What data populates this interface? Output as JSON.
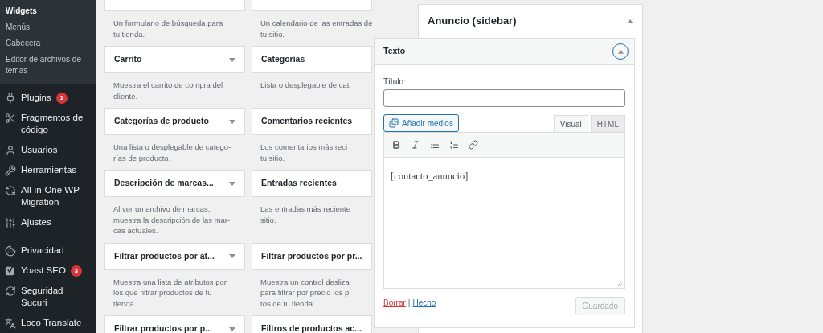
{
  "admin_menu": {
    "submenu": [
      {
        "label": "Widgets",
        "selected": true
      },
      {
        "label": "Menús",
        "selected": false
      },
      {
        "label": "Cabecera",
        "selected": false
      },
      {
        "label": "Editor de archivos de temas",
        "selected": false
      }
    ],
    "groups": [
      {
        "items": [
          {
            "label": "Plugins",
            "badge": "1"
          },
          {
            "label": "Fragmentos de código"
          },
          {
            "label": "Usuarios"
          },
          {
            "label": "Herramientas"
          },
          {
            "label": "All-in-One WP Migration"
          },
          {
            "label": "Ajustes"
          }
        ]
      },
      {
        "items": [
          {
            "label": "Privacidad"
          },
          {
            "label": "Yoast SEO",
            "badge": "3"
          },
          {
            "label": "Seguridad Sucuri"
          },
          {
            "label": "Loco Translate"
          }
        ]
      }
    ]
  },
  "available_widgets": {
    "rows": [
      {
        "left": {
          "description_lines": [
            "Un formulario de búsqueda para",
            "tu tienda."
          ]
        },
        "right": {
          "description_lines": [
            "Un calendario de las entradas de",
            "tu sitio."
          ]
        }
      },
      {
        "left": {
          "title": "Carrito",
          "description_lines": [
            "Muestra el carrito de compra del",
            "cliente."
          ]
        },
        "right": {
          "title": "Categorías",
          "description_lines": [
            "Lista o desplegable de cat"
          ]
        }
      },
      {
        "left": {
          "title": "Categorías de producto",
          "description_lines": [
            "Una lista o desplegable de catego-",
            "rías de producto."
          ]
        },
        "right": {
          "title": "Comentarios recientes",
          "description_lines": [
            "Los comentarios más reci",
            "tu sitio."
          ]
        }
      },
      {
        "left": {
          "title": "Descripción de marcas...",
          "description_lines": [
            "Al ver un archivo de marcas,",
            "muestra la descripción de las mar-",
            "cas actuales."
          ]
        },
        "right": {
          "title": "Entradas recientes",
          "description_lines": [
            "Las entradas más reciente",
            "sitio."
          ]
        }
      },
      {
        "left": {
          "title": "Filtrar productos por at...",
          "description_lines": [
            "Muestra una lista de atributos por",
            "los que filtrar productos de tu",
            "tienda."
          ]
        },
        "right": {
          "title": "Filtrar productos por pr...",
          "description_lines": [
            "Muestra un control desliza",
            "para filtrar por precio los p",
            "tos de tu tienda."
          ]
        }
      },
      {
        "left": {
          "title": "Filtrar productos por p..."
        },
        "right": {
          "title": "Filtros de productos ac..."
        }
      }
    ]
  },
  "widget_area": {
    "title": "Anuncio (sidebar)",
    "expanded": true
  },
  "text_widget": {
    "title": "Texto",
    "expanded": true,
    "title_label": "Título:",
    "media_button": "Añadir medios",
    "editor_tabs": [
      {
        "label": "Visual",
        "selected": true
      },
      {
        "label": "HTML",
        "selected": false
      }
    ],
    "content": "[contacto_anuncio]",
    "delete_link": "Borrar",
    "link_separator": "|",
    "done_link": "Hecho",
    "save_button": {
      "label": "Guardado",
      "disabled": true
    }
  }
}
